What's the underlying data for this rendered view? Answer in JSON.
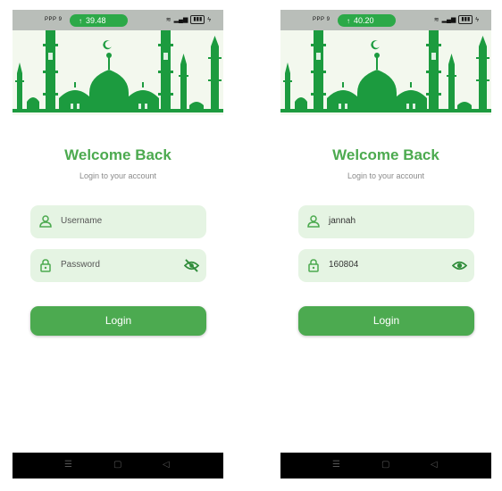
{
  "colors": {
    "accent": "#4caa4f",
    "field_bg": "#e5f4e3",
    "mosque": "#1c9b3f",
    "status_bar": "#b9beb9",
    "nav_bar": "#000000"
  },
  "screens": [
    {
      "status": {
        "left": "PPP 9",
        "timer": "39.48"
      },
      "title": "Welcome Back",
      "subtitle": "Login to your account",
      "username": {
        "value": "",
        "placeholder": "Username",
        "icon": "person-icon"
      },
      "password": {
        "value": "",
        "placeholder": "Password",
        "icon": "lock-icon",
        "visibility_icon": "eye-off-icon"
      },
      "login_label": "Login",
      "nav": {
        "menu": "☰",
        "home": "▢",
        "back": "◁"
      }
    },
    {
      "status": {
        "left": "PPP 9",
        "timer": "40.20"
      },
      "title": "Welcome Back",
      "subtitle": "Login to your account",
      "username": {
        "value": "jannah",
        "placeholder": "Username",
        "icon": "person-icon"
      },
      "password": {
        "value": "160804",
        "placeholder": "Password",
        "icon": "lock-icon",
        "visibility_icon": "eye-icon"
      },
      "login_label": "Login",
      "nav": {
        "menu": "☰",
        "home": "▢",
        "back": "◁"
      }
    }
  ]
}
